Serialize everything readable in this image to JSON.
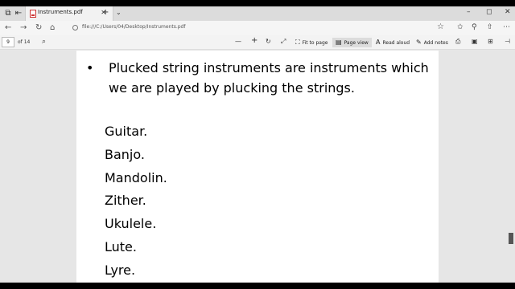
{
  "tab": {
    "title": "Instruments.pdf",
    "close_glyph": "✕",
    "newtab_glyph": "+",
    "menu_glyph": "⌄"
  },
  "window": {
    "minimize": "–",
    "maximize": "◻",
    "close": "✕"
  },
  "address": {
    "url": "file:///C:/Users/04/Desktop/Instruments.pdf"
  },
  "pdf_toolbar": {
    "page_number": "9",
    "page_count": "of 14",
    "zoom_out": "—",
    "zoom_in": "+",
    "fit_to_page": "Fit to page",
    "page_view": "Page view",
    "read_aloud": "Read aloud",
    "add_notes": "Add notes"
  },
  "document": {
    "bullet_text": "Plucked string instruments are instruments which we are played by plucking the strings.",
    "items": [
      "Guitar.",
      "Banjo.",
      "Mandolin.",
      "Zither.",
      "Ukulele.",
      "Lute.",
      "Lyre."
    ]
  },
  "colors": {
    "tabbar": "#dcdcdc",
    "addrbar": "#f5f5f5",
    "pdfbar": "#f3f3f3",
    "doc_bg": "#e6e6e6",
    "page": "#ffffff",
    "pdf_icon": "#cc3333"
  }
}
